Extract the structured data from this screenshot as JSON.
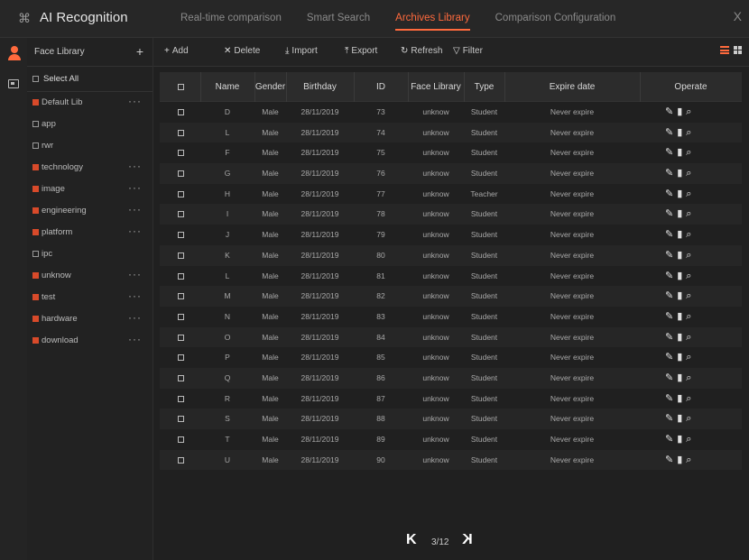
{
  "app": {
    "title": "AI Recognition",
    "tabs": [
      {
        "label": "Real-time comparison"
      },
      {
        "label": "Smart Search"
      },
      {
        "label": "Archives Library"
      },
      {
        "label": "Comparison Configuration"
      }
    ],
    "active_tab": "Archives Library",
    "close_glyph": "X",
    "accent_color": "#ff6a3d"
  },
  "sidebar": {
    "header": "Face Library",
    "add_glyph": "+",
    "select_all": "Select All",
    "more_glyph": "···",
    "items": [
      {
        "name": "Default Lib",
        "tagged": true,
        "more": true
      },
      {
        "name": "app",
        "tagged": false,
        "more": false
      },
      {
        "name": "rwr",
        "tagged": false,
        "more": false
      },
      {
        "name": "technology",
        "tagged": true,
        "more": true
      },
      {
        "name": "image",
        "tagged": true,
        "more": true
      },
      {
        "name": "engineering",
        "tagged": true,
        "more": true
      },
      {
        "name": "platform",
        "tagged": true,
        "more": true
      },
      {
        "name": "ipc",
        "tagged": false,
        "more": false
      },
      {
        "name": "unknow",
        "tagged": true,
        "more": true
      },
      {
        "name": "test",
        "tagged": true,
        "more": true
      },
      {
        "name": "hardware",
        "tagged": true,
        "more": true
      },
      {
        "name": "download",
        "tagged": true,
        "more": true
      }
    ]
  },
  "toolbar": {
    "add": "Add",
    "delete": "Delete",
    "import": "Import",
    "export": "Export",
    "refresh": "Refresh",
    "filter": "Filter"
  },
  "table": {
    "columns": [
      "",
      "Name",
      "Gender",
      "Birthday",
      "ID",
      "Face Library",
      "Type",
      "Expire date",
      "Operate"
    ],
    "rows": [
      {
        "name": "D",
        "gender": "Male",
        "birthday": "28/11/2019",
        "id": "73",
        "library": "unknow",
        "type": "Student",
        "expire": "Never expire"
      },
      {
        "name": "L",
        "gender": "Male",
        "birthday": "28/11/2019",
        "id": "74",
        "library": "unknow",
        "type": "Student",
        "expire": "Never expire"
      },
      {
        "name": "F",
        "gender": "Male",
        "birthday": "28/11/2019",
        "id": "75",
        "library": "unknow",
        "type": "Student",
        "expire": "Never expire"
      },
      {
        "name": "G",
        "gender": "Male",
        "birthday": "28/11/2019",
        "id": "76",
        "library": "unknow",
        "type": "Student",
        "expire": "Never expire"
      },
      {
        "name": "H",
        "gender": "Male",
        "birthday": "28/11/2019",
        "id": "77",
        "library": "unknow",
        "type": "Teacher",
        "expire": "Never expire"
      },
      {
        "name": "I",
        "gender": "Male",
        "birthday": "28/11/2019",
        "id": "78",
        "library": "unknow",
        "type": "Student",
        "expire": "Never expire"
      },
      {
        "name": "J",
        "gender": "Male",
        "birthday": "28/11/2019",
        "id": "79",
        "library": "unknow",
        "type": "Student",
        "expire": "Never expire"
      },
      {
        "name": "K",
        "gender": "Male",
        "birthday": "28/11/2019",
        "id": "80",
        "library": "unknow",
        "type": "Student",
        "expire": "Never expire"
      },
      {
        "name": "L",
        "gender": "Male",
        "birthday": "28/11/2019",
        "id": "81",
        "library": "unknow",
        "type": "Student",
        "expire": "Never expire"
      },
      {
        "name": "M",
        "gender": "Male",
        "birthday": "28/11/2019",
        "id": "82",
        "library": "unknow",
        "type": "Student",
        "expire": "Never expire"
      },
      {
        "name": "N",
        "gender": "Male",
        "birthday": "28/11/2019",
        "id": "83",
        "library": "unknow",
        "type": "Student",
        "expire": "Never expire"
      },
      {
        "name": "O",
        "gender": "Male",
        "birthday": "28/11/2019",
        "id": "84",
        "library": "unknow",
        "type": "Student",
        "expire": "Never expire"
      },
      {
        "name": "P",
        "gender": "Male",
        "birthday": "28/11/2019",
        "id": "85",
        "library": "unknow",
        "type": "Student",
        "expire": "Never expire"
      },
      {
        "name": "Q",
        "gender": "Male",
        "birthday": "28/11/2019",
        "id": "86",
        "library": "unknow",
        "type": "Student",
        "expire": "Never expire"
      },
      {
        "name": "R",
        "gender": "Male",
        "birthday": "28/11/2019",
        "id": "87",
        "library": "unknow",
        "type": "Student",
        "expire": "Never expire"
      },
      {
        "name": "S",
        "gender": "Male",
        "birthday": "28/11/2019",
        "id": "88",
        "library": "unknow",
        "type": "Student",
        "expire": "Never expire"
      },
      {
        "name": "T",
        "gender": "Male",
        "birthday": "28/11/2019",
        "id": "89",
        "library": "unknow",
        "type": "Student",
        "expire": "Never expire"
      },
      {
        "name": "U",
        "gender": "Male",
        "birthday": "28/11/2019",
        "id": "90",
        "library": "unknow",
        "type": "Student",
        "expire": "Never expire"
      }
    ],
    "operate_icons": [
      "edit-icon",
      "trash-icon",
      "search-icon"
    ]
  },
  "pagination": {
    "first_glyph": "K",
    "current": "3/12",
    "last_glyph": "K"
  }
}
